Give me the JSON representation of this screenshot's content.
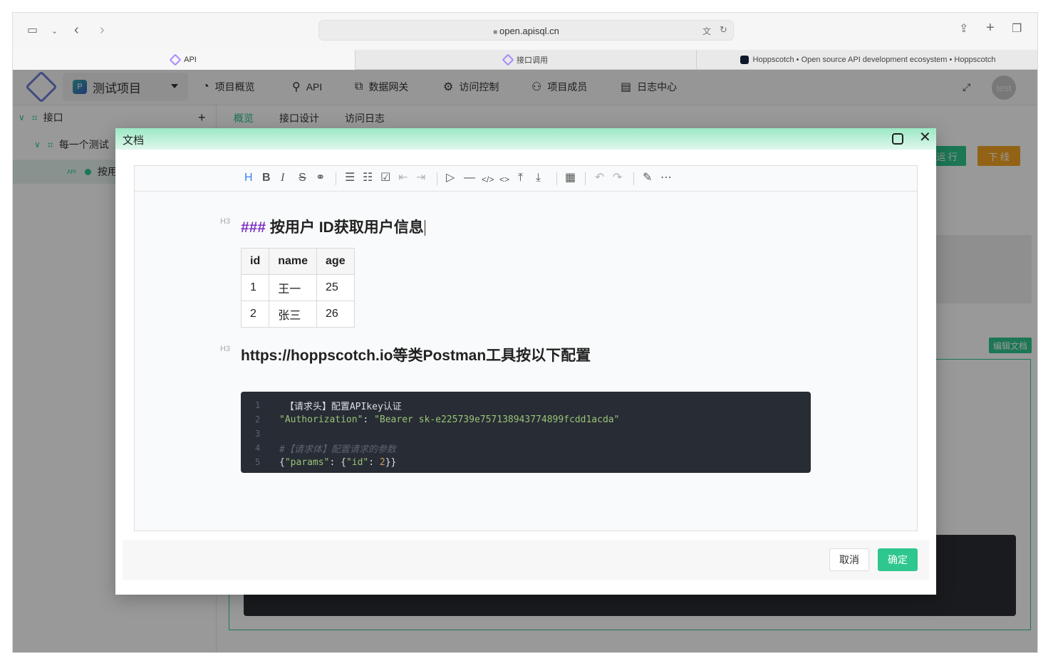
{
  "browser": {
    "url": "open.apisql.cn",
    "tabs": [
      {
        "title": "API",
        "active": true
      },
      {
        "title": "接口调用",
        "active": false
      },
      {
        "title": "Hoppscotch • Open source API development ecosystem • Hoppscotch",
        "active": false
      }
    ]
  },
  "app": {
    "project_name": "测试项目",
    "project_badge": "P",
    "nav": [
      "项目概览",
      "API",
      "数据网关",
      "访问控制",
      "项目成员",
      "日志中心"
    ],
    "avatar_text": "test",
    "sidebar": {
      "root_label": "接口",
      "group_label": "每一个测试",
      "api_tag": "API",
      "api_label": "按用"
    },
    "main_tabs": [
      "概览",
      "接口设计",
      "访问日志"
    ],
    "run_label": "运 行",
    "offline_label": "下 线",
    "edit_doc_label": "编辑文档"
  },
  "modal": {
    "title": "文档",
    "h3_tag": "H3",
    "heading1_prefix": "###",
    "heading1_text": " 按用户 ID获取用户信息",
    "table": {
      "headers": [
        "id",
        "name",
        "age"
      ],
      "rows": [
        [
          "1",
          "王一",
          "25"
        ],
        [
          "2",
          "张三",
          "26"
        ]
      ]
    },
    "heading2_text": "https://hoppscotch.io等类Postman工具按以下配置",
    "code": {
      "line_numbers": [
        "1",
        "2",
        "3",
        "4",
        "5"
      ],
      "line1": " 【请求头】配置APIkey认证",
      "line2_key": "\"Authorization\"",
      "line2_colon": ": ",
      "line2_value": "\"Bearer sk-e225739e757138943774899fcdd1acda\"",
      "line4": "#【请求体】配置请求的参数",
      "line5_open": "{",
      "line5_key": "\"params\"",
      "line5_mid": ": {",
      "line5_key2": "\"id\"",
      "line5_colon": ": ",
      "line5_num": "2",
      "line5_close": "}}"
    },
    "cancel_label": "取消",
    "confirm_label": "确定"
  },
  "colors": {
    "accent": "#2ec78d",
    "warning": "#f5a623",
    "heading_hash": "#7c2fc0",
    "code_bg": "#282c34"
  }
}
